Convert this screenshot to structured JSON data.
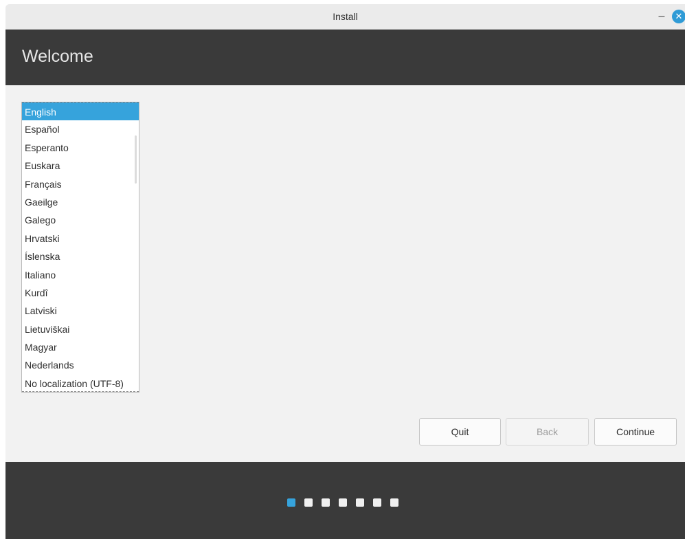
{
  "window": {
    "title": "Install"
  },
  "header": {
    "title": "Welcome"
  },
  "languages": [
    "English",
    "Español",
    "Esperanto",
    "Euskara",
    "Français",
    "Gaeilge",
    "Galego",
    "Hrvatski",
    "Íslenska",
    "Italiano",
    "Kurdî",
    "Latviski",
    "Lietuviškai",
    "Magyar",
    "Nederlands",
    "No localization (UTF-8)"
  ],
  "selected_language": "English",
  "buttons": {
    "quit": "Quit",
    "back": "Back",
    "continue": "Continue",
    "back_enabled": false
  },
  "progress": {
    "total_steps": 7,
    "current_step": 1
  },
  "icons": {
    "minimize": "minimize-icon",
    "close": "close-icon"
  },
  "colors": {
    "accent": "#36a3dc",
    "header_bg": "#3a3a3a"
  }
}
